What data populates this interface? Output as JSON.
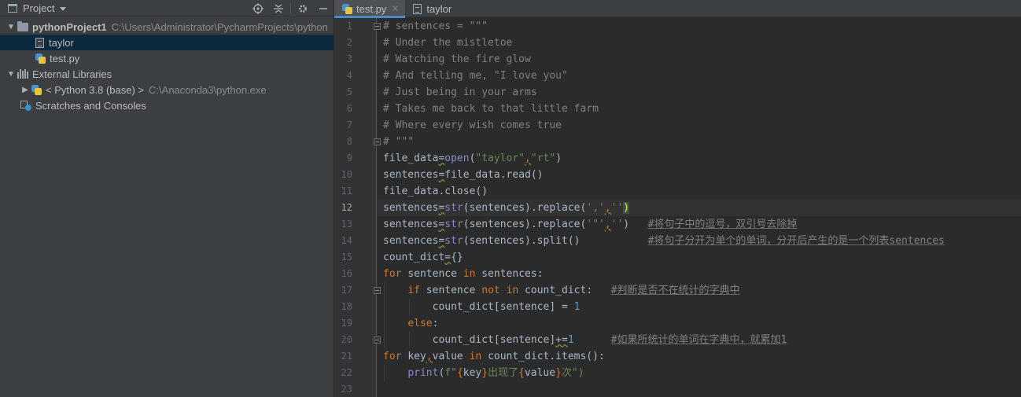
{
  "project_pane": {
    "title": "Project",
    "tree": [
      {
        "name": "pythonProject1",
        "path": "C:\\Users\\Administrator\\PycharmProjects\\python"
      },
      {
        "name": "taylor"
      },
      {
        "name": "test.py"
      },
      {
        "name": "External Libraries"
      },
      {
        "name": "< Python 3.8 (base) >",
        "path": "C:\\Anaconda3\\python.exe"
      },
      {
        "name": "Scratches and Consoles"
      }
    ]
  },
  "tabs": [
    {
      "label": "test.py",
      "active": true
    },
    {
      "label": "taylor",
      "active": false
    }
  ],
  "current_line": 12,
  "line_numbers": [
    "1",
    "2",
    "3",
    "4",
    "5",
    "6",
    "7",
    "8",
    "9",
    "10",
    "11",
    "12",
    "13",
    "14",
    "15",
    "16",
    "17",
    "18",
    "19",
    "20",
    "21",
    "22",
    "23"
  ],
  "code": {
    "l1": "# sentences = \"\"\"",
    "l2": "# Under the mistletoe",
    "l3": "# Watching the fire glow",
    "l4": "# And telling me, \"I love you\"",
    "l5": "# Just being in your arms",
    "l6": "# Takes me back to that little farm",
    "l7": "# Where every wish comes true",
    "l8": "# \"\"\"",
    "t": {
      "file_data": "file_data",
      "eq": "=",
      "open": "open",
      "lp": "(",
      "rp": ")",
      "s_taylor": "\"taylor\"",
      "comma": ",",
      "s_rt": "\"rt\"",
      "sentences": "sentences",
      "read_call": "file_data.read()",
      "close_call": "file_data.close()",
      "str": "str",
      "paren_sentences": "(sentences)",
      "replace_open": ".replace(",
      "q_comma": "','",
      "q_empty": "''",
      "q_dq": "'\"'",
      "split_call": ".split()",
      "count_dict": "count_dict",
      "braces": "{}",
      "kw_for": "for",
      "kw_in": "in",
      "kw_if": "if",
      "kw_not": "not",
      "kw_else": "else",
      "sentence": "sentence",
      "sentences_colon": "sentences:",
      "count_dict_colon": "count_dict:",
      "else_colon": ":",
      "cd_index": "count_dict[sentence]",
      "assign_eq": " = ",
      "one": "1",
      "plus_eq": "+=",
      "key": "key",
      "value": "value",
      "items_call": "count_dict.items():",
      "print": "print",
      "f": "f",
      "fstr_q": "\"",
      "lbrace": "{",
      "rbrace": "}",
      "appeared": "出现了",
      "times": "次",
      "close_fstr": "\")"
    },
    "comments": {
      "c13": "#将句子中的逗号，双引号去除掉",
      "c14": "#将句子分开为单个的单词，分开后产生的是一个列表sentences",
      "c17": "#判断是否不在统计的字典中",
      "c20": "#如果所统计的单词在字典中，就累加1"
    }
  }
}
